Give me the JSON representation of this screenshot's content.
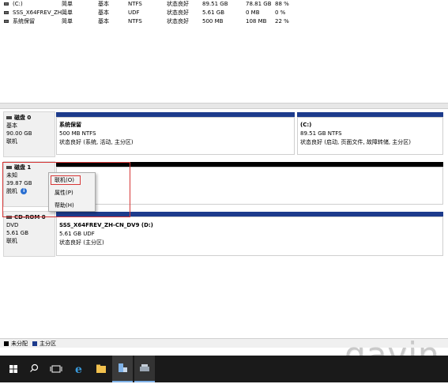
{
  "volumes": [
    {
      "name": "(C:)",
      "layout": "简单",
      "type": "基本",
      "fs": "NTFS",
      "status": "状态良好",
      "capacity": "89.51 GB",
      "free": "78.81 GB",
      "pct": "88 %"
    },
    {
      "name": "SSS_X64FREV_ZH...",
      "layout": "简单",
      "type": "基本",
      "fs": "UDF",
      "status": "状态良好",
      "capacity": "5.61 GB",
      "free": "0 MB",
      "pct": "0 %"
    },
    {
      "name": "系统保留",
      "layout": "简单",
      "type": "基本",
      "fs": "NTFS",
      "status": "状态良好",
      "capacity": "500 MB",
      "free": "108 MB",
      "pct": "22 %"
    }
  ],
  "disks": {
    "disk0": {
      "title": "磁盘 0",
      "type": "基本",
      "size": "90.00 GB",
      "state": "联机",
      "partitions": [
        {
          "name": "系统保留",
          "size": "500 MB NTFS",
          "status": "状态良好 (系统, 活动, 主分区)"
        },
        {
          "name": "(C:)",
          "size": "89.51 GB NTFS",
          "status": "状态良好 (启动, 页面文件, 故障转储, 主分区)"
        }
      ]
    },
    "disk1": {
      "title": "磁盘 1",
      "type": "未知",
      "size": "39.87 GB",
      "state": "脱机"
    },
    "cdrom0": {
      "title": "CD-ROM 0",
      "type": "DVD",
      "size": "5.61 GB",
      "state": "联机",
      "partition": {
        "name": "SSS_X64FREV_ZH-CN_DV9  (D:)",
        "size": "5.61 GB UDF",
        "status": "状态良好 (主分区)"
      }
    }
  },
  "context_menu": {
    "online": "联机(O)",
    "properties": "属性(P)",
    "help": "帮助(H)"
  },
  "legend": {
    "unallocated": "未分配",
    "primary": "主分区"
  },
  "watermark": "gavin",
  "colors": {
    "partition_bar": "#1d3b8c",
    "unallocated": "#000000",
    "highlight": "#d73737",
    "taskbar": "#1a1a1a"
  }
}
